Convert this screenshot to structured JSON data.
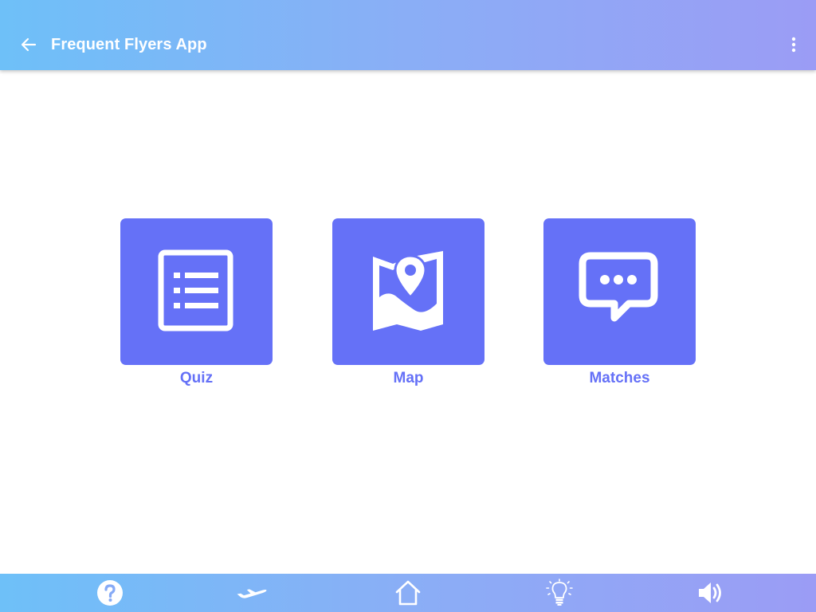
{
  "app": {
    "title": "Frequent Flyers App"
  },
  "topbar": {
    "back_icon": "arrow-back-icon",
    "menu_icon": "more-vertical-icon"
  },
  "tiles": [
    {
      "label": "Quiz",
      "icon": "list-icon"
    },
    {
      "label": "Map",
      "icon": "map-pin-icon"
    },
    {
      "label": "Matches",
      "icon": "chat-bubble-icon"
    }
  ],
  "bottom_nav": [
    {
      "id": "help",
      "icon": "question-icon"
    },
    {
      "id": "flight",
      "icon": "airplane-icon"
    },
    {
      "id": "home",
      "icon": "home-icon"
    },
    {
      "id": "tips",
      "icon": "lightbulb-icon"
    },
    {
      "id": "sound",
      "icon": "speaker-icon"
    }
  ],
  "colors": {
    "accent": "#6571f7",
    "bar_gradient_start": "#6ec0f8",
    "bar_gradient_end": "#9b9cf5",
    "icon_white": "#ffffff"
  }
}
